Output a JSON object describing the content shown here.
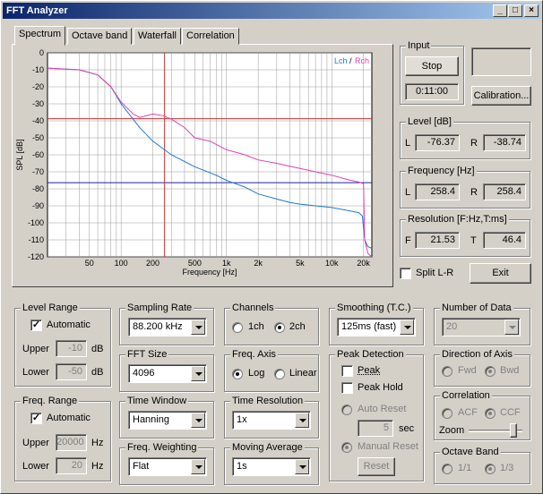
{
  "window": {
    "title": "FFT Analyzer"
  },
  "tabs": [
    "Spectrum",
    "Octave band",
    "Waterfall",
    "Correlation"
  ],
  "chart_data": {
    "type": "line",
    "ylabel": "SPL [dB]",
    "xlabel": "Frequency [Hz]",
    "legend": {
      "lch": "Lch",
      "sep": "/",
      "rch": "Rch",
      "placement": "top-right"
    },
    "xscale": "log",
    "xlim": [
      20,
      24000
    ],
    "ylim": [
      -120,
      0
    ],
    "yticks": [
      0,
      -10,
      -20,
      -30,
      -40,
      -50,
      -60,
      -70,
      -80,
      -90,
      -100,
      -110,
      -120
    ],
    "xticks": [
      {
        "v": 50,
        "t": "50"
      },
      {
        "v": 100,
        "t": "100"
      },
      {
        "v": 200,
        "t": "200"
      },
      {
        "v": 500,
        "t": "500"
      },
      {
        "v": 1000,
        "t": "1k"
      },
      {
        "v": 2000,
        "t": "2k"
      },
      {
        "v": 5000,
        "t": "5k"
      },
      {
        "v": 10000,
        "t": "10k"
      },
      {
        "v": 20000,
        "t": "20k"
      }
    ],
    "grid": true,
    "cursor_freq_hz": 258.4,
    "level_lines": {
      "L": -76.37,
      "R": -38.74
    },
    "series": [
      {
        "name": "Lch",
        "color": "#1e78d2",
        "points": [
          [
            20,
            -9
          ],
          [
            40,
            -10
          ],
          [
            60,
            -13
          ],
          [
            80,
            -20
          ],
          [
            100,
            -30
          ],
          [
            150,
            -44
          ],
          [
            200,
            -52
          ],
          [
            300,
            -60
          ],
          [
            500,
            -67
          ],
          [
            800,
            -72
          ],
          [
            1000,
            -75
          ],
          [
            1500,
            -79
          ],
          [
            2000,
            -83
          ],
          [
            3000,
            -86
          ],
          [
            4000,
            -88
          ],
          [
            5000,
            -89
          ],
          [
            7000,
            -90
          ],
          [
            10000,
            -91
          ],
          [
            15000,
            -93
          ],
          [
            18000,
            -94
          ],
          [
            19500,
            -96
          ],
          [
            20500,
            -110
          ],
          [
            22000,
            -114
          ],
          [
            24000,
            -115
          ]
        ]
      },
      {
        "name": "Rch",
        "color": "#e040b0",
        "points": [
          [
            20,
            -9
          ],
          [
            40,
            -10
          ],
          [
            60,
            -13
          ],
          [
            80,
            -20
          ],
          [
            100,
            -29
          ],
          [
            130,
            -36
          ],
          [
            150,
            -38
          ],
          [
            200,
            -36
          ],
          [
            250,
            -37
          ],
          [
            300,
            -39
          ],
          [
            400,
            -44
          ],
          [
            500,
            -50
          ],
          [
            700,
            -52
          ],
          [
            1000,
            -57
          ],
          [
            1500,
            -60
          ],
          [
            2000,
            -63
          ],
          [
            3000,
            -65
          ],
          [
            5000,
            -68
          ],
          [
            7000,
            -70
          ],
          [
            10000,
            -72
          ],
          [
            15000,
            -75
          ],
          [
            18000,
            -76
          ],
          [
            20000,
            -77
          ],
          [
            20500,
            -110
          ],
          [
            22000,
            -118
          ],
          [
            24000,
            -120
          ]
        ]
      }
    ]
  },
  "input": {
    "title": "Input",
    "stop_label": "Stop",
    "time": "0:11:00",
    "calibration_label": "Calibration..."
  },
  "level": {
    "title": "Level [dB]",
    "l_label": "L",
    "l_value": "-76.37",
    "r_label": "R",
    "r_value": "-38.74"
  },
  "frequency": {
    "title": "Frequency [Hz]",
    "l_label": "L",
    "l_value": "258.4",
    "r_label": "R",
    "r_value": "258.4"
  },
  "resolution": {
    "title": "Resolution [F:Hz,T:ms]",
    "f_label": "F",
    "f_value": "21.53",
    "t_label": "T",
    "t_value": "46.4"
  },
  "split_label": "Split L-R",
  "exit_label": "Exit",
  "level_range": {
    "title": "Level Range",
    "auto_label": "Automatic",
    "upper_label": "Upper",
    "upper_value": "-10",
    "lower_label": "Lower",
    "lower_value": "-50",
    "unit": "dB"
  },
  "freq_range": {
    "title": "Freq. Range",
    "auto_label": "Automatic",
    "upper_label": "Upper",
    "upper_value": "20000",
    "lower_label": "Lower",
    "lower_value": "20",
    "unit": "Hz"
  },
  "sampling_rate": {
    "title": "Sampling Rate",
    "value": "88.200 kHz"
  },
  "fft_size": {
    "title": "FFT Size",
    "value": "4096"
  },
  "time_window": {
    "title": "Time Window",
    "value": "Hanning"
  },
  "freq_weighting": {
    "title": "Freq. Weighting",
    "value": "Flat"
  },
  "channels": {
    "title": "Channels",
    "opt1": "1ch",
    "opt2": "2ch"
  },
  "freq_axis": {
    "title": "Freq. Axis",
    "opt1": "Log",
    "opt2": "Linear"
  },
  "time_resolution": {
    "title": "Time Resolution",
    "value": "1x"
  },
  "moving_average": {
    "title": "Moving Average",
    "value": "1s"
  },
  "smoothing": {
    "title": "Smoothing (T.C.)",
    "value": "125ms (fast)"
  },
  "peak_detection": {
    "title": "Peak Detection",
    "peak_label": "Peak",
    "peak_hold_label": "Peak Hold",
    "auto_reset_label": "Auto Reset",
    "sec_value": "5",
    "sec_label": "sec",
    "manual_reset_label": "Manual Reset",
    "reset_label": "Reset"
  },
  "number_of_data": {
    "title": "Number of Data",
    "value": "20"
  },
  "direction_of_axis": {
    "title": "Direction of Axis",
    "opt1": "Fwd",
    "opt2": "Bwd"
  },
  "correlation": {
    "title": "Correlation",
    "opt1": "ACF",
    "opt2": "CCF",
    "zoom_label": "Zoom"
  },
  "octave_band": {
    "title": "Octave Band",
    "opt1": "1/1",
    "opt2": "1/3"
  }
}
